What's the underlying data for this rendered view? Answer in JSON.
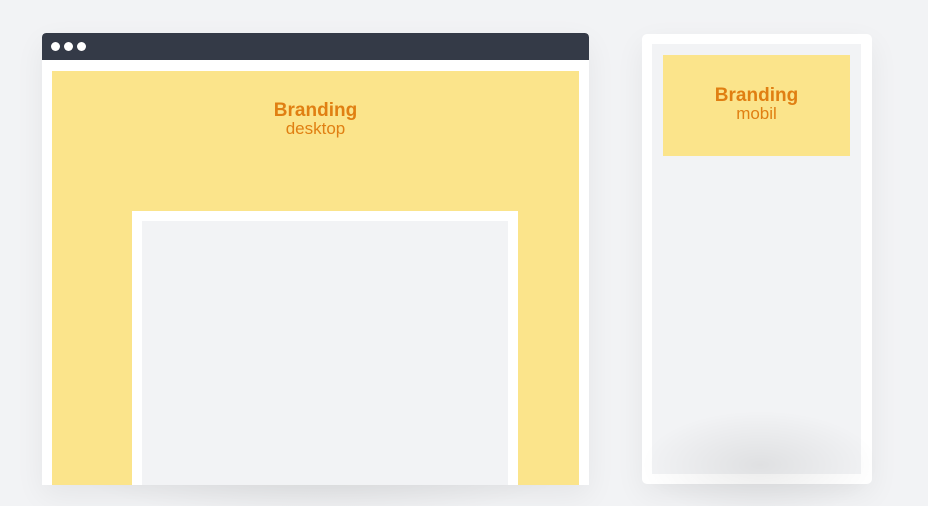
{
  "desktop": {
    "branding_title": "Branding",
    "branding_subtitle": "desktop"
  },
  "mobile": {
    "branding_title": "Branding",
    "branding_subtitle": "mobil"
  },
  "colors": {
    "branding_fill": "#fbe48b",
    "branding_text": "#e07f12",
    "titlebar": "#343a47",
    "content_area": "#f2f3f5",
    "frame": "#ffffff"
  },
  "icons": [
    "window-control-dot-icon",
    "window-control-dot-icon",
    "window-control-dot-icon"
  ]
}
